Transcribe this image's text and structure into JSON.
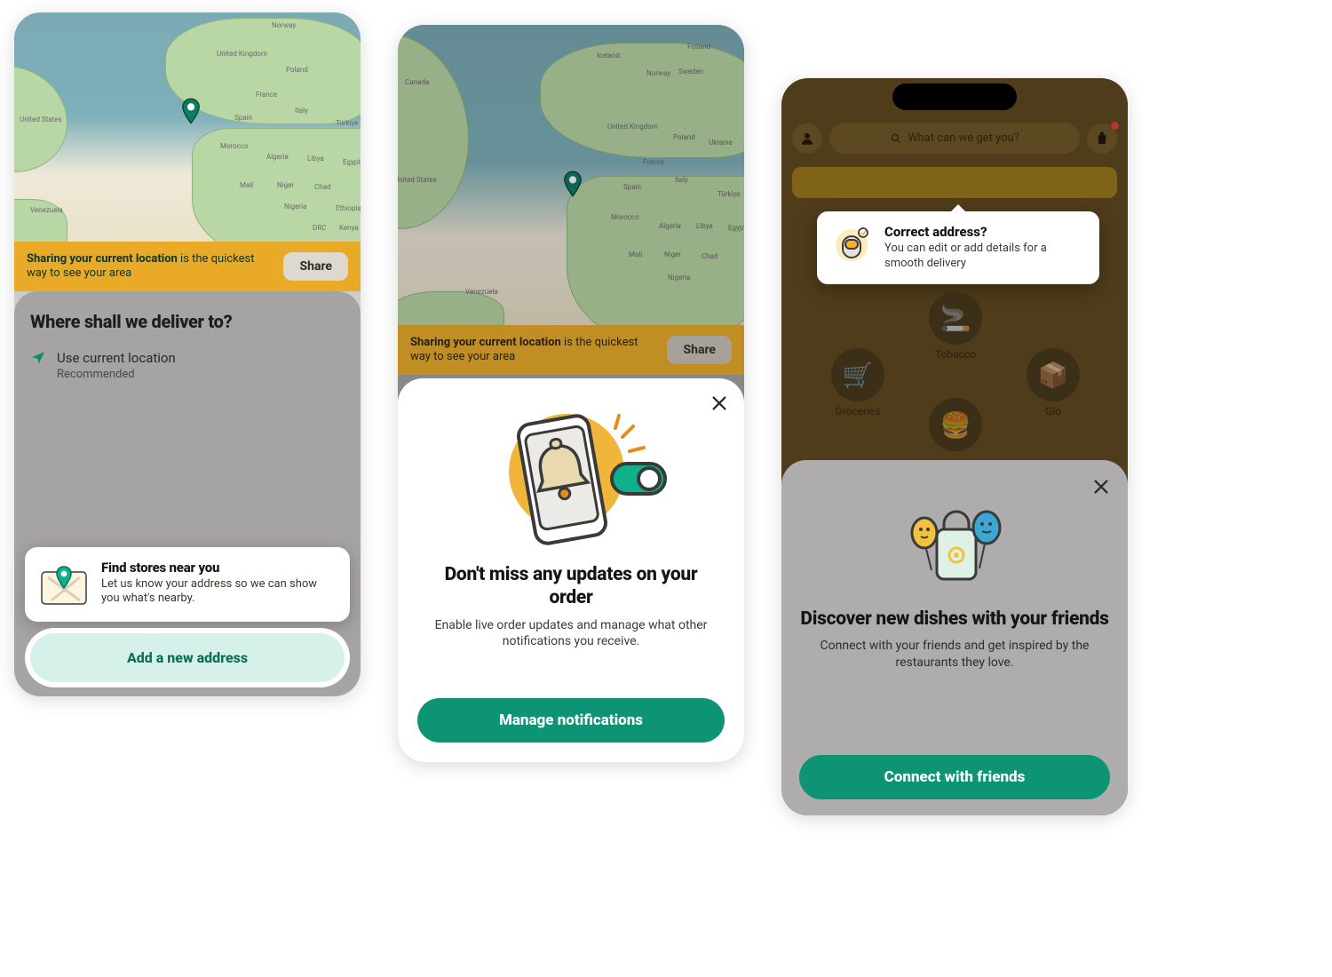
{
  "colors": {
    "accent": "#0d9474",
    "banner": "#e8aa27",
    "accent_light": "#d6f0ea"
  },
  "screen1": {
    "banner_bold": "Sharing your current location",
    "banner_rest": " is the quickest way to see your area",
    "share": "Share",
    "heading": "Where shall we deliver to?",
    "loc_title": "Use current location",
    "loc_sub": "Recommended",
    "card_title": "Find stores near you",
    "card_body": "Let us know your address so we can show you what's nearby.",
    "cta": "Add a new address",
    "map_labels": [
      "Norway",
      "United Kingdom",
      "Poland",
      "France",
      "Spain",
      "Italy",
      "Türkiye",
      "United States",
      "Morocco",
      "Algeria",
      "Libya",
      "Egypt",
      "Mali",
      "Niger",
      "Chad",
      "Nigeria",
      "Ethiopia",
      "Venezuela",
      "DRC",
      "Kenya"
    ]
  },
  "screen2": {
    "banner_bold": "Sharing your current location",
    "banner_rest": " is the quickest way to see your area",
    "share": "Share",
    "title": "Don't miss any updates on your order",
    "subtitle": "Enable live order updates and manage what other notifications you receive.",
    "cta": "Manage notifications",
    "map_labels": [
      "Iceland",
      "Finland",
      "Norway",
      "Sweden",
      "United Kingdom",
      "Poland",
      "Ukraine",
      "France",
      "Spain",
      "Italy",
      "Türkiye",
      "Canada",
      "United States",
      "Morocco",
      "Algeria",
      "Libya",
      "Egypt",
      "Mali",
      "Niger",
      "Chad",
      "Nigeria",
      "Venezuela"
    ]
  },
  "screen3": {
    "search_placeholder": "What can we get you?",
    "tooltip_title": "Correct address?",
    "tooltip_body": "You can edit or add details for a smooth delivery",
    "categories": {
      "tobacco": "Tobacco",
      "groceries": "Groceries",
      "glo": "Glo"
    },
    "modal_title": "Discover new dishes with your friends",
    "modal_subtitle": "Connect with your friends and get inspired by the restaurants they love.",
    "cta": "Connect with friends"
  }
}
